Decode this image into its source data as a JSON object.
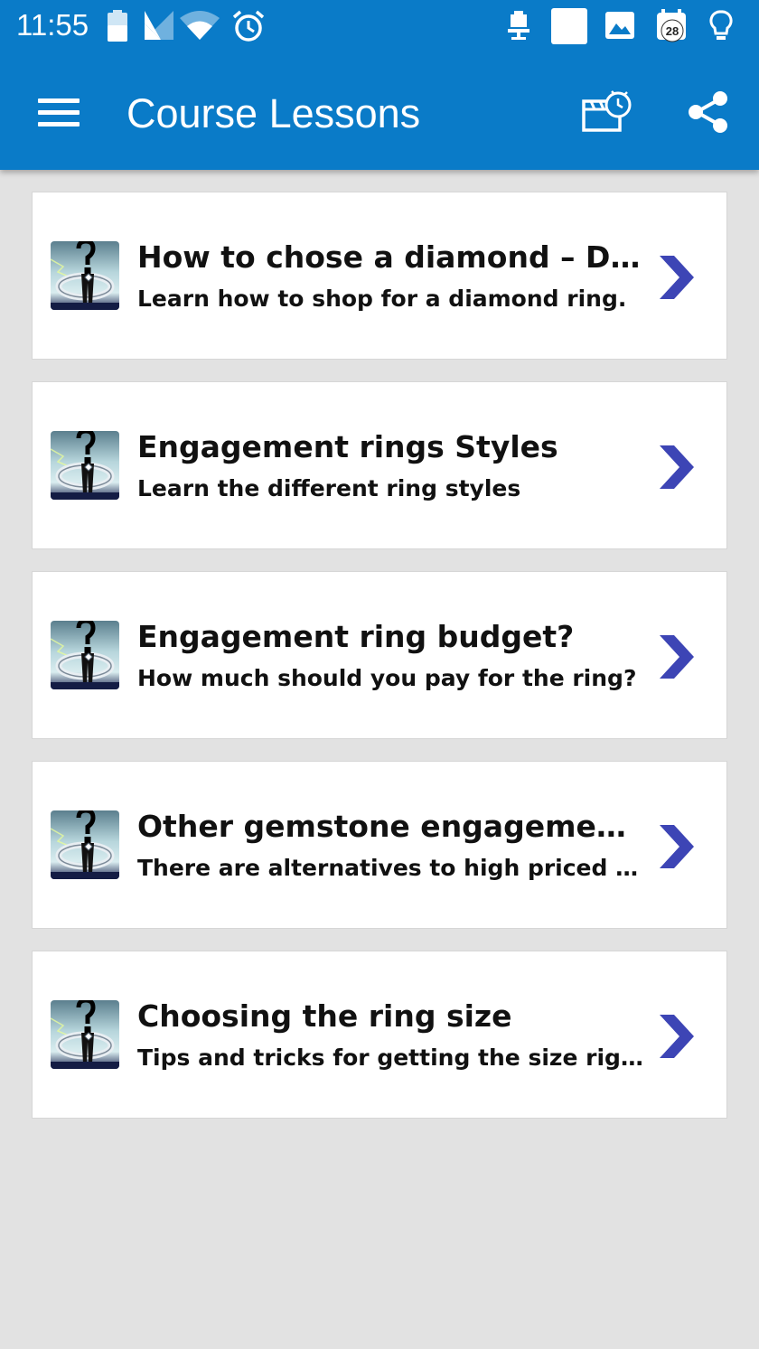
{
  "status_bar": {
    "time": "11:55",
    "notification_badge": "28",
    "icons": [
      "battery-icon",
      "cell-signal-icon",
      "wifi-icon",
      "alarm-icon",
      "usb-debug-icon",
      "blank-notification-icon",
      "image-icon",
      "calendar-badge-icon",
      "lightbulb-icon"
    ]
  },
  "toolbar": {
    "title": "Course Lessons",
    "icons": [
      "menu-icon",
      "schedule-icon",
      "share-icon"
    ]
  },
  "colors": {
    "app_bar": "#0a7bc8",
    "background": "#e2e2e2",
    "card": "#ffffff",
    "chevron": "#3d45b5",
    "text": "#111111"
  },
  "lessons": [
    {
      "title": "How to chose a diamond – Diamond basics",
      "subtitle": "Learn how to shop for a diamond ring.",
      "icon": "ring-question-thumbnail"
    },
    {
      "title": "Engagement rings Styles",
      "subtitle": "Learn the different ring styles",
      "icon": "ring-question-thumbnail"
    },
    {
      "title": "Engagement ring budget?",
      "subtitle": "How much should you pay for the ring?",
      "icon": "ring-question-thumbnail"
    },
    {
      "title": "Other gemstone engagement rings",
      "subtitle": "There are alternatives to high priced diamond rings",
      "icon": "ring-question-thumbnail"
    },
    {
      "title": "Choosing the ring size",
      "subtitle": "Tips and tricks for getting the size right",
      "icon": "ring-question-thumbnail"
    }
  ]
}
